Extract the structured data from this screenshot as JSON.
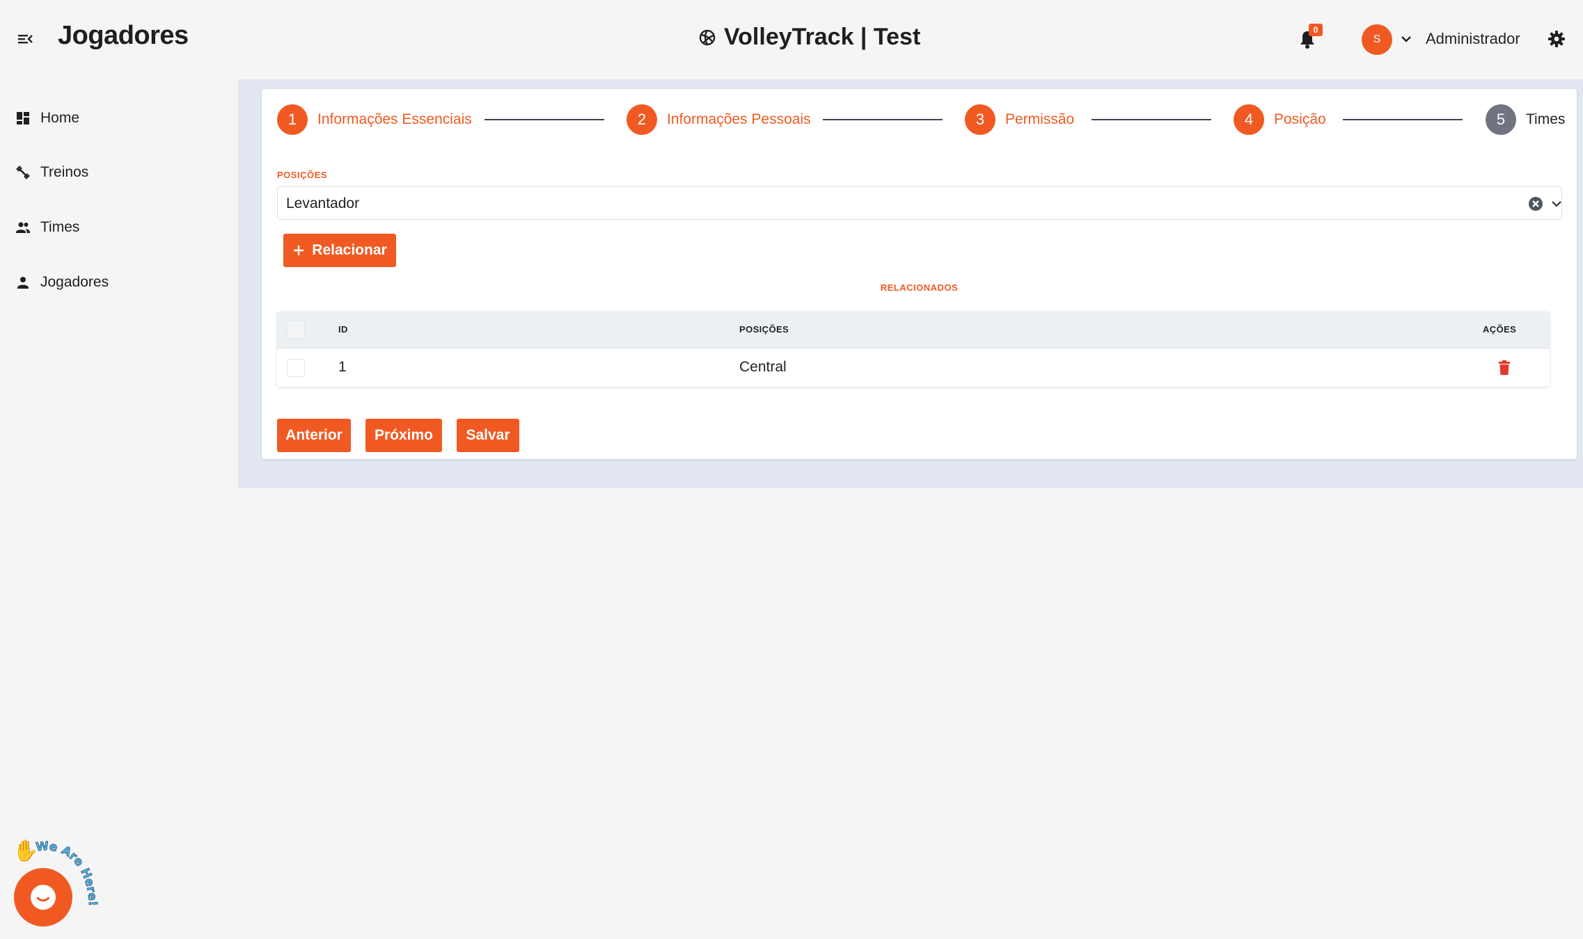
{
  "header": {
    "page_title": "Jogadores",
    "brand": "VolleyTrack | Test",
    "notification_count": "0",
    "avatar_initial": "S",
    "user_name": "Administrador"
  },
  "sidebar": {
    "items": [
      {
        "label": "Home",
        "icon": "dashboard-icon"
      },
      {
        "label": "Treinos",
        "icon": "dumbbell-icon"
      },
      {
        "label": "Times",
        "icon": "group-icon"
      },
      {
        "label": "Jogadores",
        "icon": "person-icon"
      }
    ]
  },
  "stepper": {
    "steps": [
      {
        "number": "1",
        "label": "Informações Essenciais",
        "state": "done"
      },
      {
        "number": "2",
        "label": "Informações Pessoais",
        "state": "done"
      },
      {
        "number": "3",
        "label": "Permissão",
        "state": "done"
      },
      {
        "number": "4",
        "label": "Posição",
        "state": "active"
      },
      {
        "number": "5",
        "label": "Times",
        "state": "pending"
      }
    ]
  },
  "form": {
    "positions_label": "POSIÇÕES",
    "positions_value": "Levantador",
    "relate_button": "Relacionar",
    "related_label": "RELACIONADOS"
  },
  "table": {
    "columns": {
      "id": "ID",
      "positions": "POSIÇÕES",
      "actions": "AÇÕES"
    },
    "rows": [
      {
        "id": "1",
        "position": "Central"
      }
    ]
  },
  "actions": {
    "previous": "Anterior",
    "next": "Próximo",
    "save": "Salvar"
  },
  "chat": {
    "tagline": "We Are Here!"
  },
  "colors": {
    "accent": "#f05a22",
    "pending_step": "#6f7480",
    "danger": "#e0392b",
    "band": "#e3e7f1"
  }
}
